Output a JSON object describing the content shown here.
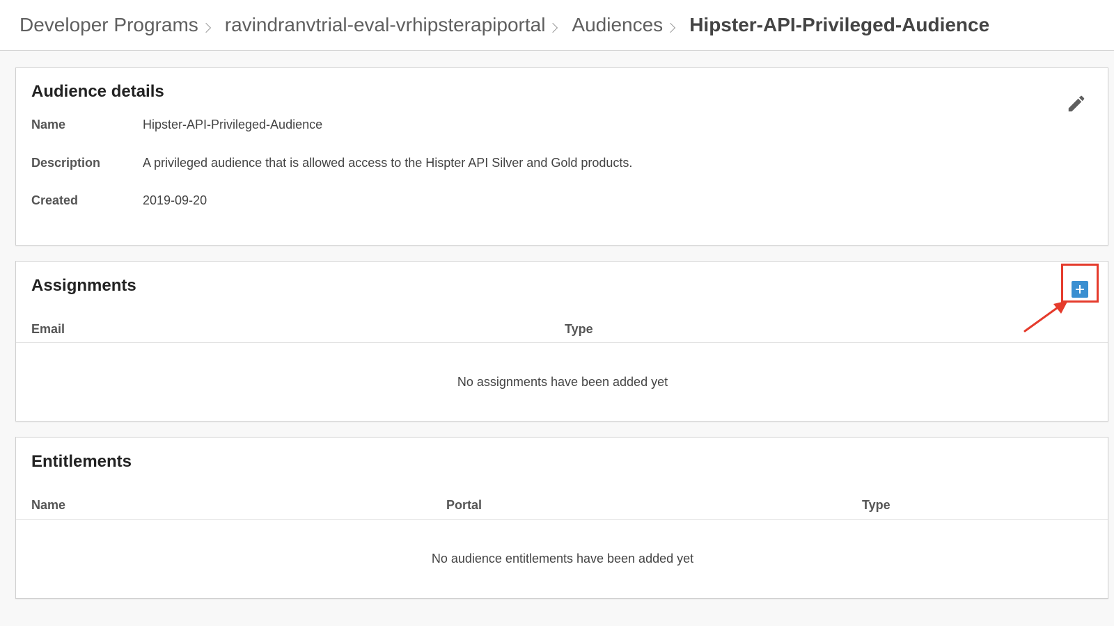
{
  "breadcrumb": {
    "items": [
      "Developer Programs",
      "ravindranvtrial-eval-vrhipsterapiportal",
      "Audiences"
    ],
    "current": "Hipster-API-Privileged-Audience"
  },
  "audience_details": {
    "title": "Audience details",
    "fields": [
      {
        "label": "Name",
        "value": "Hipster-API-Privileged-Audience"
      },
      {
        "label": "Description",
        "value": "A privileged audience that is allowed access to the Hispter API Silver and Gold products."
      },
      {
        "label": "Created",
        "value": "2019-09-20"
      }
    ],
    "edit_icon": "pencil-icon"
  },
  "assignments": {
    "title": "Assignments",
    "columns": [
      "Email",
      "Type"
    ],
    "empty_message": "No assignments have been added yet",
    "add_icon": "plus-icon"
  },
  "entitlements": {
    "title": "Entitlements",
    "columns": [
      "Name",
      "Portal",
      "Type"
    ],
    "empty_message": "No audience entitlements have been added yet"
  },
  "colors": {
    "accent": "#3a8fd1",
    "annotation": "#e53b2c"
  }
}
